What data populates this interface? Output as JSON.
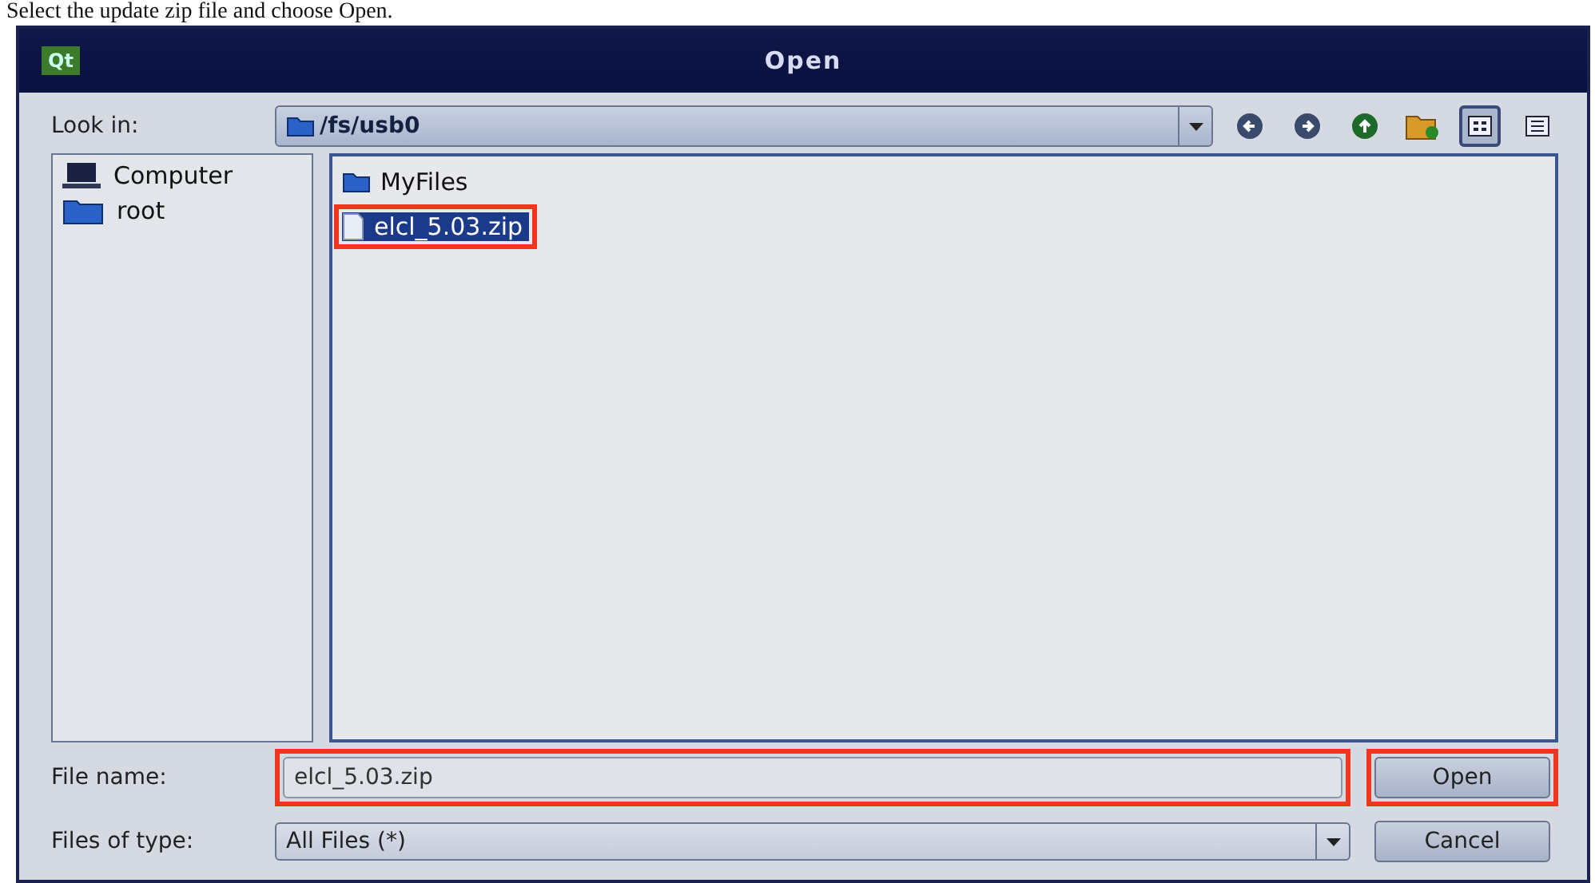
{
  "caption": "Select the update zip file and choose Open.",
  "window": {
    "title": "Open",
    "app_badge": "Qt"
  },
  "look_in": {
    "label": "Look in:",
    "value": "/fs/usb0"
  },
  "toolbar": [
    {
      "kind": "back"
    },
    {
      "kind": "forward"
    },
    {
      "kind": "up"
    },
    {
      "kind": "new-folder"
    },
    {
      "kind": "icon-view",
      "selected": true
    },
    {
      "kind": "list-view",
      "selected": false
    }
  ],
  "sidebar": {
    "items": [
      {
        "kind": "computer",
        "label": "Computer"
      },
      {
        "kind": "folder",
        "label": "root"
      }
    ]
  },
  "files": [
    {
      "kind": "folder",
      "name": "MyFiles",
      "selected": false,
      "highlighted": false
    },
    {
      "kind": "file",
      "name": "elcl_5.03.zip",
      "selected": true,
      "highlighted": true
    }
  ],
  "file_name": {
    "label": "File name:",
    "value": "elcl_5.03.zip",
    "highlighted": true
  },
  "file_type": {
    "label": "Files of type:",
    "value": "All Files (*)"
  },
  "buttons": [
    {
      "label": "Open",
      "highlighted": true
    },
    {
      "label": "Cancel",
      "highlighted": false
    }
  ]
}
